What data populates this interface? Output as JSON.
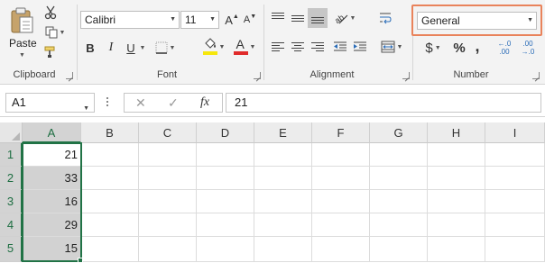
{
  "ribbon": {
    "clipboard": {
      "label": "Clipboard",
      "paste_label": "Paste"
    },
    "font": {
      "label": "Font",
      "font_name": "Calibri",
      "font_size": "11",
      "bold": "B",
      "italic": "I",
      "underline": "U",
      "font_color_glyph": "A",
      "grow_glyph": "A",
      "shrink_glyph": "A",
      "font_color_bar": "#e02b2b",
      "highlight_bar": "#f6e70c"
    },
    "alignment": {
      "label": "Alignment"
    },
    "number": {
      "label": "Number",
      "format_value": "General",
      "currency_glyph": "$",
      "percent_glyph": "%",
      "comma_glyph": ",",
      "increase_decimal": "←.0 .00",
      "decrease_decimal": ".00 →.0",
      "highlight_color": "#e9835b"
    }
  },
  "formula_bar": {
    "name_box": "A1",
    "cancel_glyph": "✕",
    "enter_glyph": "✓",
    "fx_glyph": "fx",
    "content": "21"
  },
  "sheet": {
    "columns": [
      "A",
      "B",
      "C",
      "D",
      "E",
      "F",
      "G",
      "H",
      "I"
    ],
    "rows": [
      "1",
      "2",
      "3",
      "4",
      "5"
    ],
    "column_a_values": [
      "21",
      "33",
      "16",
      "29",
      "15"
    ],
    "selected_column": "A",
    "accent_color": "#217346"
  }
}
